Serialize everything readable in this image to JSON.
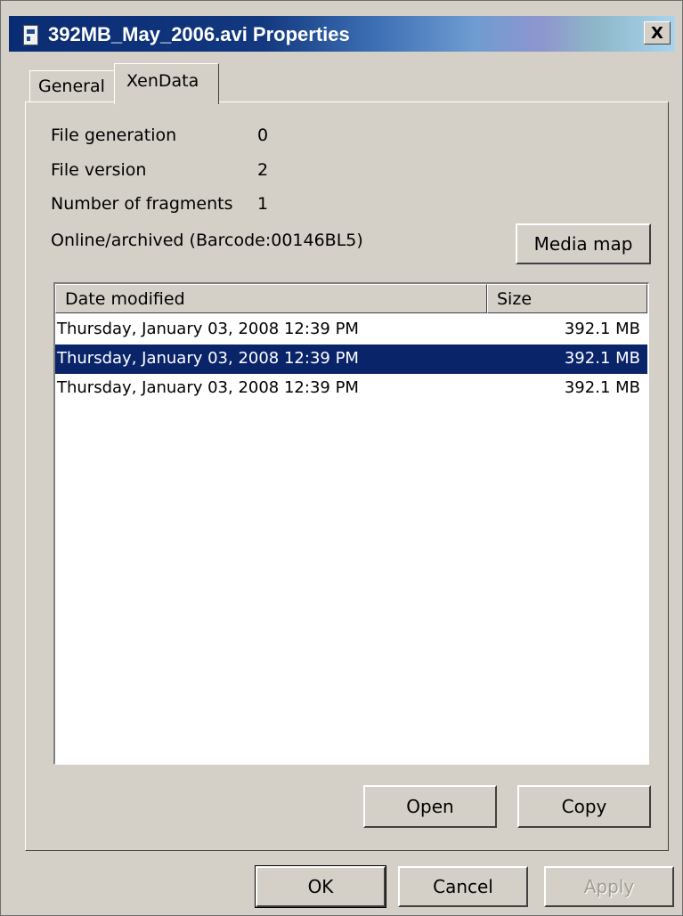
{
  "window": {
    "title": "392MB_May_2006.avi Properties",
    "close_glyph": "X"
  },
  "tabs": [
    {
      "label": "General",
      "active": false
    },
    {
      "label": "XenData",
      "active": true
    }
  ],
  "info": {
    "file_generation_label": "File generation",
    "file_generation_value": "0",
    "file_version_label": "File version",
    "file_version_value": "2",
    "fragments_label": "Number of fragments",
    "fragments_value": "1",
    "status_text": "Online/archived (Barcode:00146BL5)"
  },
  "media_map_button": "Media map",
  "list": {
    "columns": [
      "Date modified",
      "Size"
    ],
    "rows": [
      {
        "date": "Thursday, January 03, 2008 12:39 PM",
        "size": "392.1 MB",
        "selected": false
      },
      {
        "date": "Thursday, January 03, 2008 12:39 PM",
        "size": "392.1 MB",
        "selected": true
      },
      {
        "date": "Thursday, January 03, 2008 12:39 PM",
        "size": "392.1 MB",
        "selected": false
      }
    ]
  },
  "panel_buttons": {
    "open": "Open",
    "copy": "Copy"
  },
  "dialog_buttons": {
    "ok": "OK",
    "cancel": "Cancel",
    "apply": "Apply"
  },
  "colors": {
    "selection": "#0a246a",
    "face": "#d4d0c8",
    "title_start": "#0a2c73",
    "title_end": "#a8d4ef"
  }
}
